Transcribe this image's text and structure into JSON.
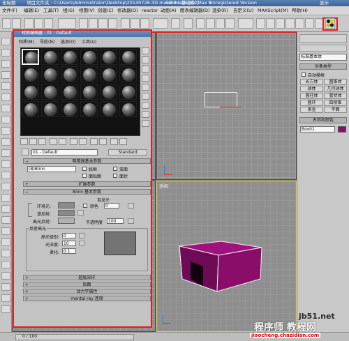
{
  "app": {
    "title_icon": "无标题",
    "project_folder": "项目文件夹 : C:\\Users\\Administrator\\Desktop\\20140726-3D max9.0 - 基础练习",
    "title": "Autodesk 3ds Max 9",
    "license": "Unregistered Version",
    "help_hint": "显示"
  },
  "menu": [
    "文件(F)",
    "编辑(E)",
    "工具(T)",
    "组(G)",
    "视图(V)",
    "创建(C)",
    "修改器(O)",
    "reactor",
    "动画(A)",
    "图表编辑器(D)",
    "渲染(R)",
    "自定义(U)",
    "MAXScript(M)",
    "帮助(H)"
  ],
  "viewports": {
    "top_left_label": "",
    "top_right_label": "",
    "perspective_label": "透视"
  },
  "command_panel": {
    "dropdown": "标准基本体",
    "object_type_title": "对象类型",
    "autogrid": "自动栅格",
    "buttons": [
      "长方体",
      "圆锥体",
      "球体",
      "几何球体",
      "圆柱体",
      "管状体",
      "圆环",
      "四棱锥",
      "茶壶",
      "平面"
    ],
    "name_color_title": "名称和颜色",
    "name_value": "Box01"
  },
  "material_editor": {
    "title": "材质编辑器 - 01 - Default",
    "menu": [
      "材质(M)",
      "导航(N)",
      "选项(O)",
      "工具(U)"
    ],
    "material_name": "01 - Default",
    "material_type": "Standard",
    "shader_basic_title": "明暗器基本参数",
    "shader_name": "(B)Blinn",
    "wire": "线框",
    "two_sided": "双面",
    "face_map": "面贴图",
    "faceted": "面状",
    "extended_title": "扩展参数",
    "blinn_title": "Blinn 基本参数",
    "self_illum_title": "自发光",
    "color_label": "颜色",
    "color_value": "0",
    "ambient": "环境光:",
    "diffuse": "漫反射:",
    "specular": "高光反射:",
    "opacity_label": "不透明度",
    "opacity_value": "100",
    "spec_highlights_title": "反射高光",
    "spec_level_label": "高光级别:",
    "spec_level_value": "0",
    "glossiness_label": "光泽度:",
    "glossiness_value": "10",
    "soften_label": "柔化:",
    "soften_value": "0.1",
    "supersampling_title": "超级采样",
    "maps_title": "贴图",
    "dynamics_title": "动力学属性",
    "mental_ray_title": "mental ray 连接"
  },
  "status": {
    "frame": "0 / 100"
  },
  "watermarks": {
    "top": "jb51.net",
    "main": "程序师 教程网",
    "url": "jiaocheng.chazidian.com"
  },
  "colors": {
    "highlight_red": "#e0201b",
    "box_magenta": "#8b0d6a",
    "selection_white": "#f0f0f0"
  }
}
